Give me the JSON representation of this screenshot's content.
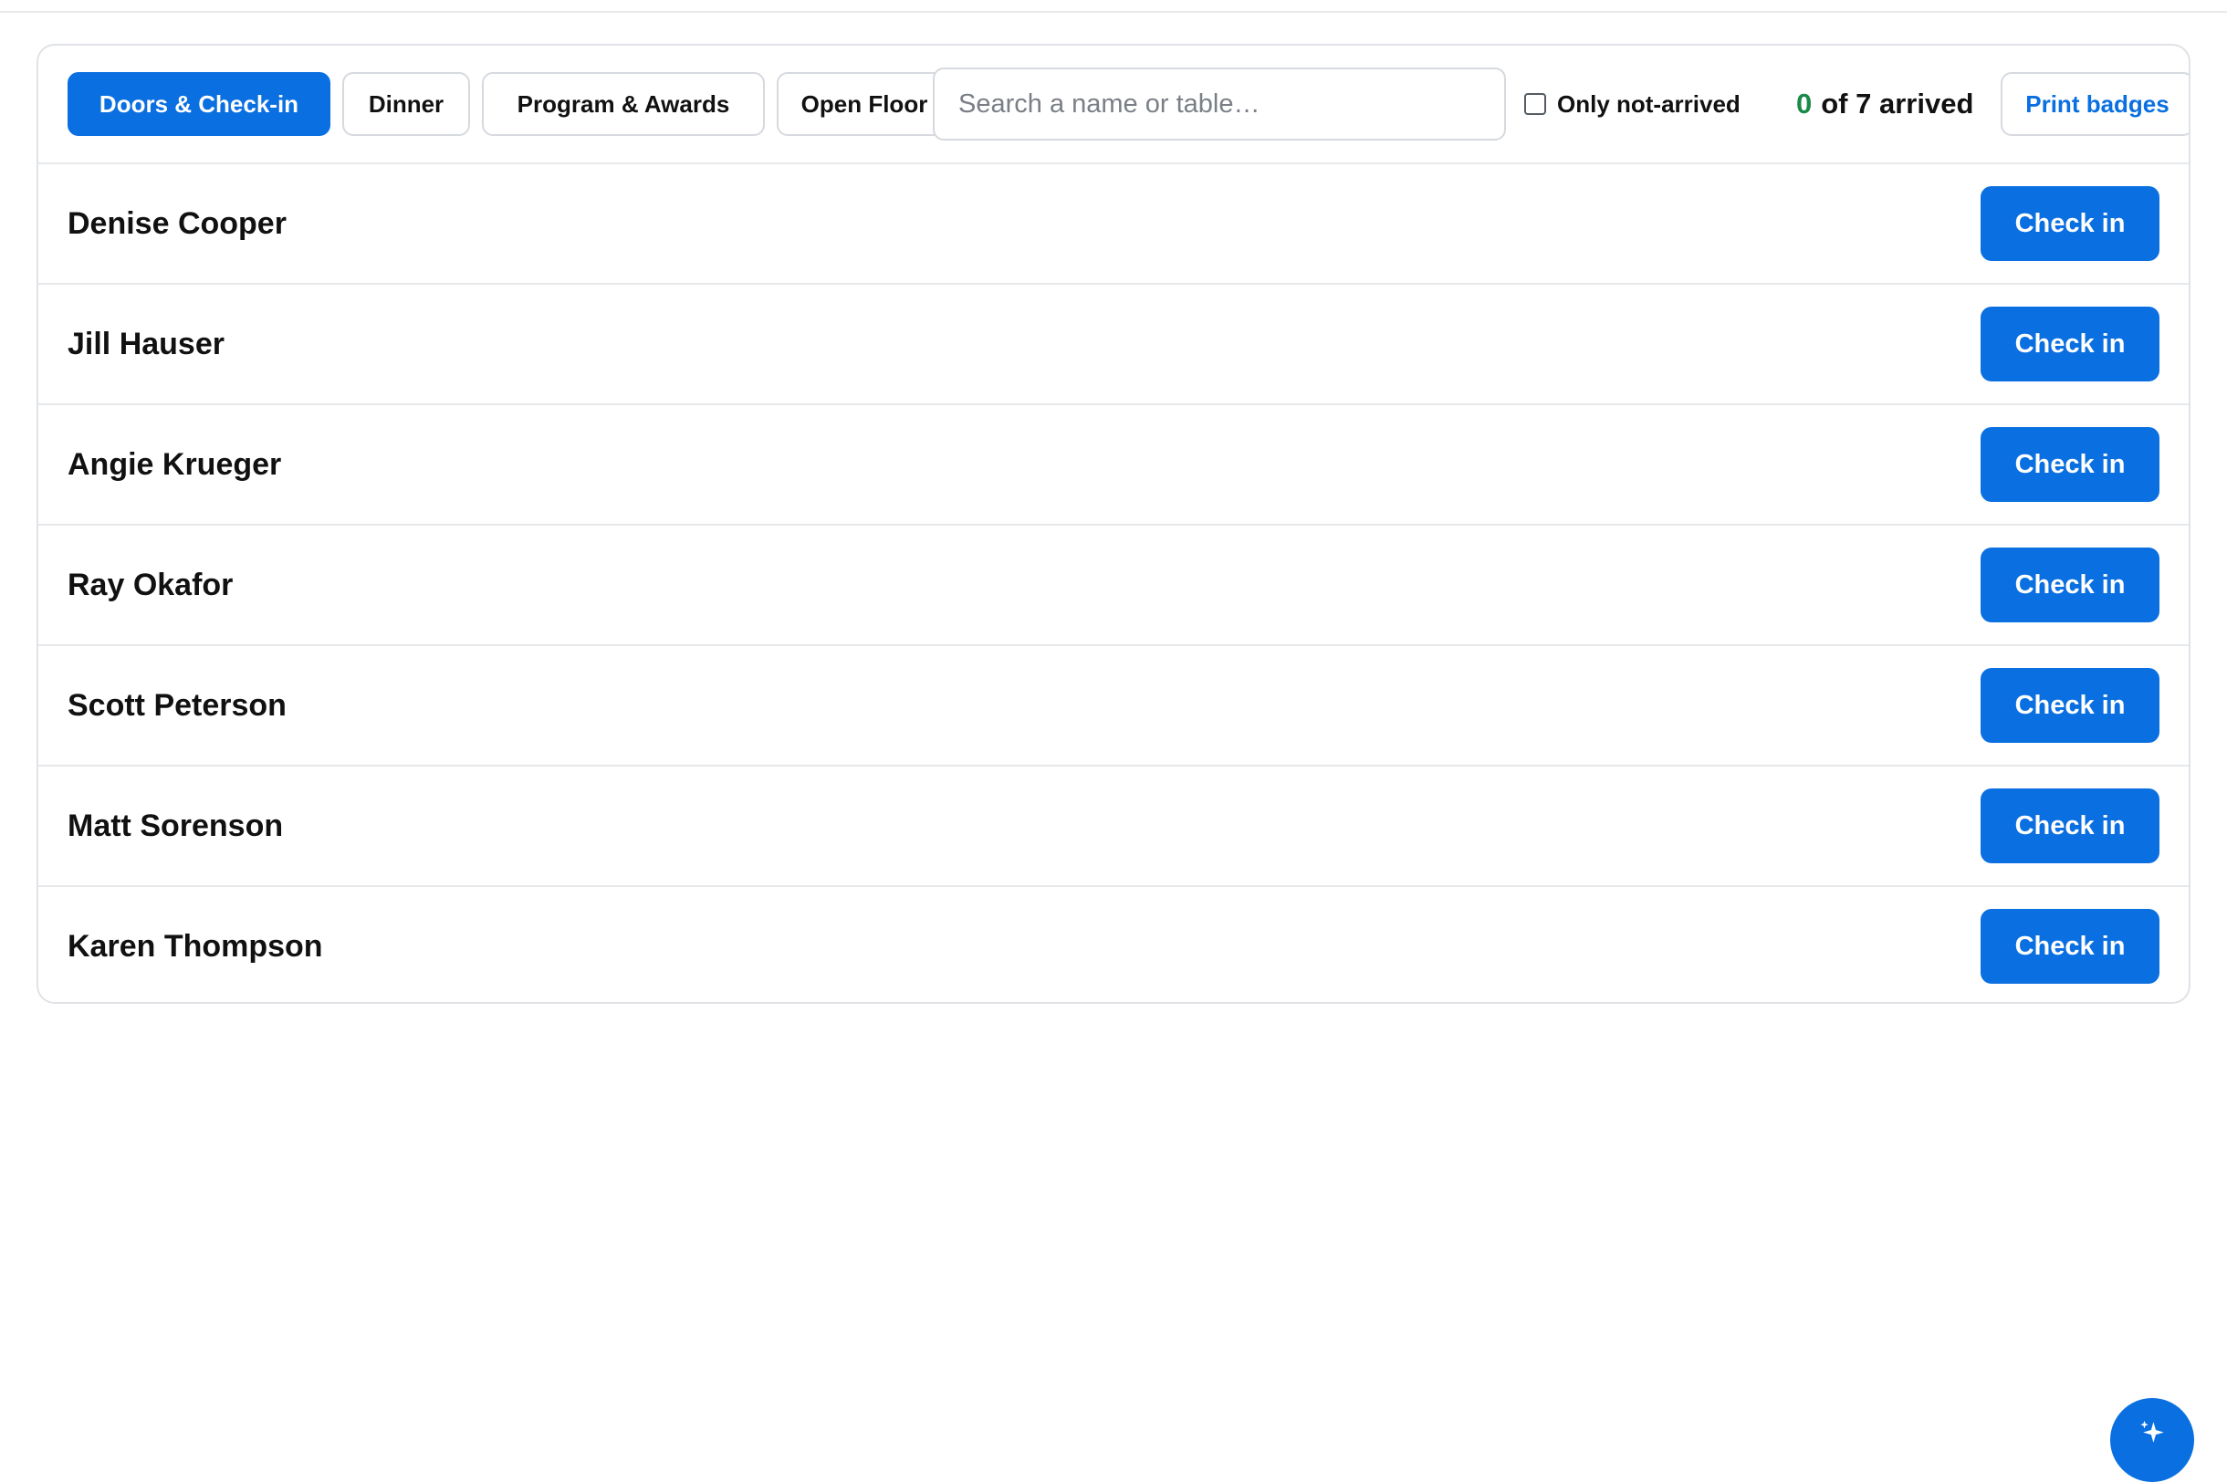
{
  "tabs": [
    {
      "label": "Doors & Check-in",
      "active": true
    },
    {
      "label": "Dinner",
      "active": false
    },
    {
      "label": "Program & Awards",
      "active": false
    },
    {
      "label": "Open Floor",
      "active": false
    }
  ],
  "search": {
    "placeholder": "Search a name or table…",
    "value": ""
  },
  "filter": {
    "label": "Only not-arrived",
    "checked": false
  },
  "arrival": {
    "count": "0",
    "total_text": "of 7 arrived"
  },
  "print_badges_label": "Print badges",
  "guests": [
    {
      "name": "Denise Cooper",
      "action": "Check in"
    },
    {
      "name": "Jill Hauser",
      "action": "Check in"
    },
    {
      "name": "Angie Krueger",
      "action": "Check in"
    },
    {
      "name": "Ray Okafor",
      "action": "Check in"
    },
    {
      "name": "Scott Peterson",
      "action": "Check in"
    },
    {
      "name": "Matt Sorenson",
      "action": "Check in"
    },
    {
      "name": "Karen Thompson",
      "action": "Check in"
    }
  ],
  "colors": {
    "accent": "#0a6fe0",
    "arrived_count": "#1a8a4a",
    "border": "#d6d9de"
  },
  "fab_icon": "sparkle-icon"
}
